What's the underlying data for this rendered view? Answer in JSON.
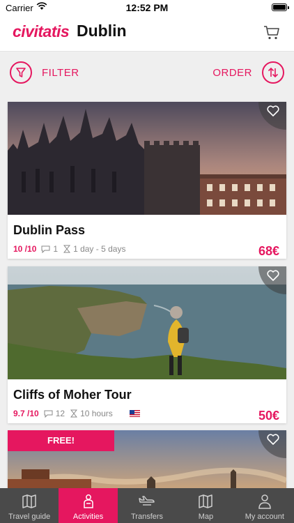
{
  "status": {
    "carrier": "Carrier",
    "time": "12:52 PM"
  },
  "header": {
    "brand": "civitatis",
    "city": "Dublin",
    "cart_icon": "cart-icon"
  },
  "toolbar": {
    "filter_label": "FILTER",
    "order_label": "ORDER",
    "filter_icon": "funnel-icon",
    "order_icon": "sort-arrows-icon"
  },
  "activities": [
    {
      "title": "Dublin Pass",
      "rating": "10 /10",
      "reviews": "1",
      "duration": "1 day - 5 days",
      "price": "68€",
      "photo": "Dublin Castle at sunset"
    },
    {
      "title": "Cliffs of Moher Tour",
      "rating": "9.7 /10",
      "reviews": "12",
      "duration": "10 hours",
      "price": "50€",
      "language_flag": "us-flag-icon",
      "photo": "Hiker overlooking the Cliffs of Moher"
    },
    {
      "badge": "FREE!",
      "photo": "Dublin buildings at sunset"
    }
  ],
  "tabs": [
    {
      "label": "Travel guide",
      "icon": "map-book-icon",
      "active": false
    },
    {
      "label": "Activities",
      "icon": "person-icon",
      "active": true
    },
    {
      "label": "Transfers",
      "icon": "plane-icon",
      "active": false
    },
    {
      "label": "Map",
      "icon": "map-icon",
      "active": false
    },
    {
      "label": "My account",
      "icon": "user-icon",
      "active": false
    }
  ],
  "colors": {
    "accent": "#e5175f",
    "tabbar": "#4a4a4a"
  }
}
